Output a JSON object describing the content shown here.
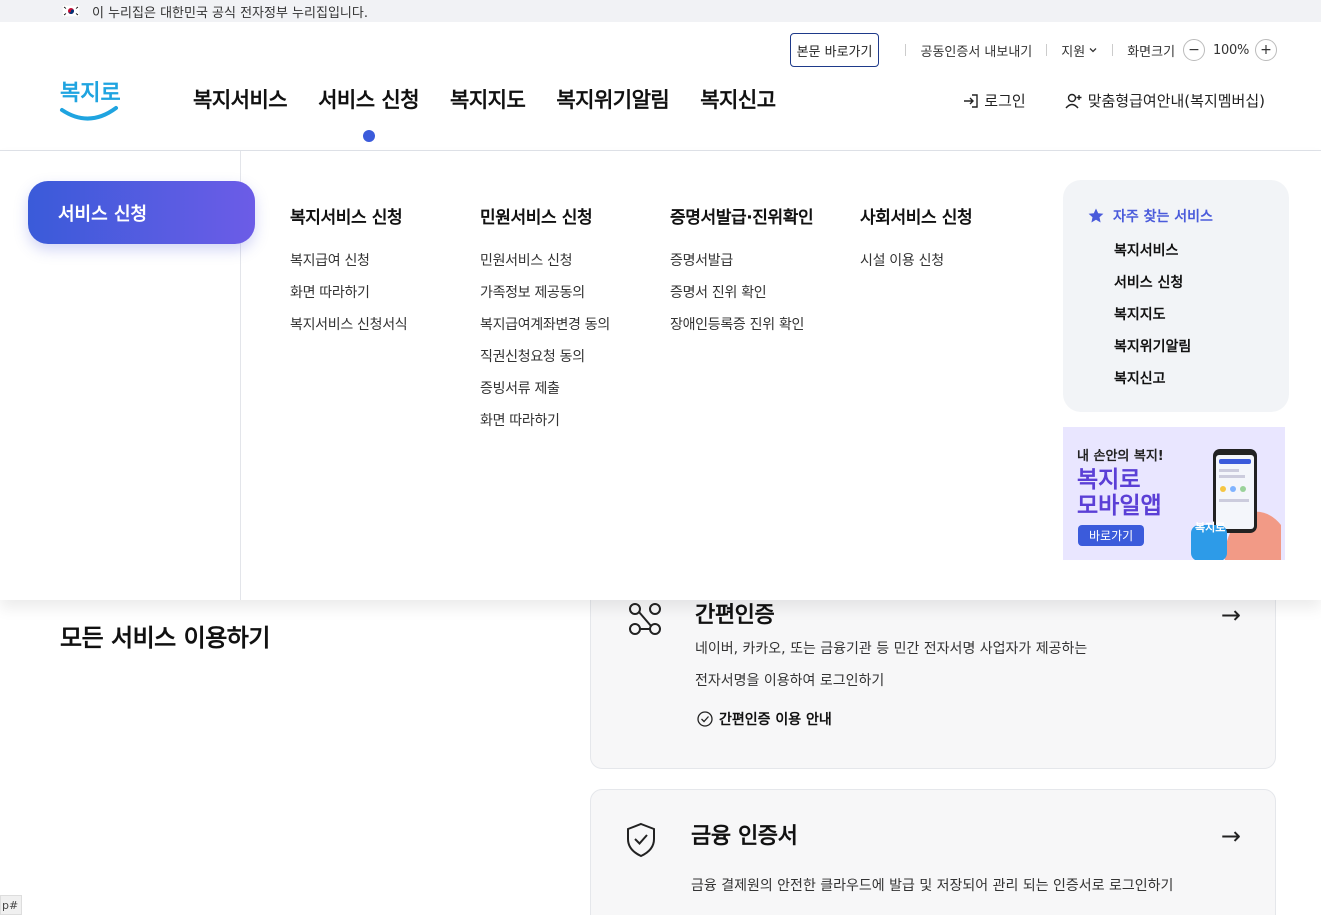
{
  "gov_banner": {
    "text": "이 누리집은 대한민국 공식 전자정부 누리집입니다."
  },
  "utility": {
    "skip_label": "본문 바로가기",
    "cert_export": "공동인증서 내보내기",
    "support": "지원",
    "zoom_label": "화면크기",
    "zoom_minus": "−",
    "zoom_value": "100%",
    "zoom_plus": "+"
  },
  "logo": {
    "text": "복지로"
  },
  "gnb": {
    "items": [
      {
        "label": "복지서비스"
      },
      {
        "label": "서비스 신청"
      },
      {
        "label": "복지지도"
      },
      {
        "label": "복지위기알림"
      },
      {
        "label": "복지신고"
      }
    ],
    "active_index": 1
  },
  "header_right": {
    "login": "로그인",
    "membership": "맞춤형급여안내(복지멤버십)"
  },
  "mega_menu": {
    "pill_label": "서비스 신청",
    "columns": [
      {
        "title": "복지서비스 신청",
        "items": [
          "복지급여 신청",
          "화면 따라하기",
          "복지서비스 신청서식"
        ]
      },
      {
        "title": "민원서비스 신청",
        "items": [
          "민원서비스 신청",
          "가족정보 제공동의",
          "복지급여계좌변경 동의",
          "직권신청요청 동의",
          "증빙서류 제출",
          "화면 따라하기"
        ]
      },
      {
        "title": "증명서발급·진위확인",
        "items": [
          "증명서발급",
          "증명서 진위 확인",
          "장애인등록증 진위 확인"
        ]
      },
      {
        "title": "사회서비스 신청",
        "items": [
          "시설 이용 신청"
        ]
      }
    ],
    "favorites": {
      "title": "자주 찾는 서비스",
      "items": [
        "복지서비스",
        "서비스 신청",
        "복지지도",
        "복지위기알림",
        "복지신고"
      ]
    },
    "banner": {
      "line1": "내 손안의 복지!",
      "line2": "복지로",
      "line3": "모바일앱",
      "button": "바로가기",
      "badge": "복지로"
    }
  },
  "content": {
    "section_title": "모든 서비스 이용하기",
    "cards": [
      {
        "title": "간편인증",
        "desc1": "네이버, 카카오, 또는 금융기관 등 민간 전자서명 사업자가 제공하는",
        "desc2": "전자서명을 이용하여 로그인하기",
        "guide": "간편인증 이용 안내",
        "arrow": "→"
      },
      {
        "title": "금융 인증서",
        "desc1": "금융 결제원의 안전한 클라우드에 발급 및 저장되어 관리 되는 인증서로 로그인하기",
        "arrow": "→"
      }
    ]
  },
  "corner_tag": "p#",
  "colors": {
    "primary": "#3b5bdb",
    "accent_purple": "#6c5ce7",
    "fav_title": "#4a5bdb"
  }
}
